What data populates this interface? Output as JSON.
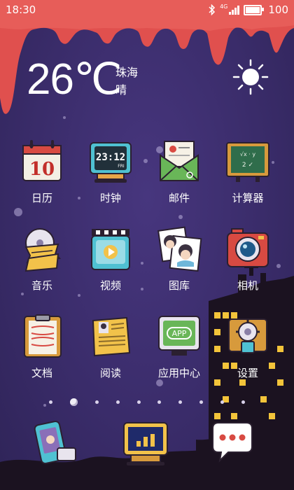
{
  "status": {
    "time": "18:30",
    "network": "4G",
    "battery": "100",
    "icons": [
      "bluetooth-icon",
      "signal-icon",
      "battery-icon"
    ]
  },
  "weather": {
    "temperature": "26",
    "unit": "℃",
    "city": "珠海",
    "condition": "晴",
    "icon": "sun-icon"
  },
  "apps": [
    {
      "label": "日历",
      "icon": "calendar-icon",
      "day": "10"
    },
    {
      "label": "时钟",
      "icon": "clock-icon",
      "time": "23:12",
      "day": "FRI"
    },
    {
      "label": "邮件",
      "icon": "mail-icon"
    },
    {
      "label": "计算器",
      "icon": "calculator-icon"
    },
    {
      "label": "音乐",
      "icon": "music-icon"
    },
    {
      "label": "视频",
      "icon": "video-icon"
    },
    {
      "label": "图库",
      "icon": "gallery-icon"
    },
    {
      "label": "相机",
      "icon": "camera-icon"
    },
    {
      "label": "文档",
      "icon": "document-icon"
    },
    {
      "label": "阅读",
      "icon": "reader-icon"
    },
    {
      "label": "应用中心",
      "icon": "app-center-icon",
      "screen_text": "APP"
    },
    {
      "label": "设置",
      "icon": "settings-icon"
    }
  ],
  "page_indicator": {
    "count": 10,
    "active_index": 1
  },
  "dock": [
    {
      "icon": "phone-icon"
    },
    {
      "icon": "browser-icon"
    },
    {
      "icon": "messages-icon"
    }
  ],
  "colors": {
    "background": "#3a2c6a",
    "drip": "#e0504e",
    "label": "#ffffff",
    "building": "#1b1220",
    "window": "#f3c43a"
  }
}
